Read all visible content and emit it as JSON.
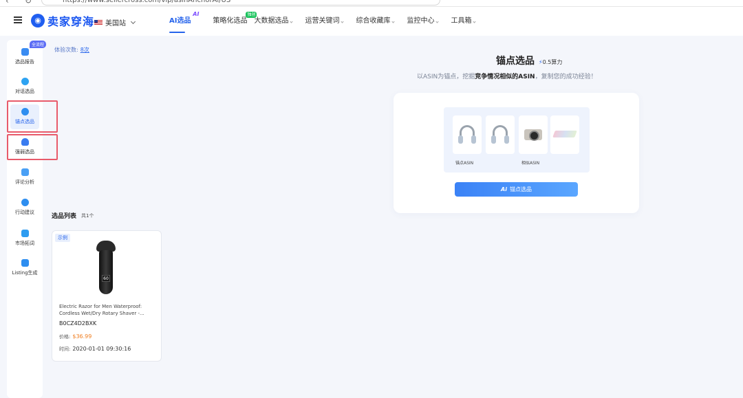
{
  "browser": {
    "url": "https://www.sellercross.com/vip/asinAnchorAi/US"
  },
  "header": {
    "logo_text": "卖家穿海",
    "site": "美国站",
    "nav": [
      {
        "label": "AI选品",
        "badge": "AI"
      },
      {
        "label": "策略化选品",
        "badge": "独创"
      },
      {
        "label": "大数据选品"
      },
      {
        "label": "运营关键词"
      },
      {
        "label": "综合收藏库"
      },
      {
        "label": "监控中心"
      },
      {
        "label": "工具箱"
      }
    ]
  },
  "sidebar": {
    "badge": "全流程",
    "items": [
      {
        "label": "选品报告",
        "icon": "report-icon"
      },
      {
        "label": "对话选品",
        "icon": "chat-icon"
      },
      {
        "label": "锚点选品",
        "icon": "anchor-icon"
      },
      {
        "label": "强弱选品",
        "icon": "person-icon"
      },
      {
        "label": "评论分析",
        "icon": "comment-icon"
      },
      {
        "label": "行动建议",
        "icon": "compass-icon"
      },
      {
        "label": "市场拓词",
        "icon": "keyword-icon"
      },
      {
        "label": "Listing生成",
        "icon": "listing-icon"
      }
    ]
  },
  "trial": {
    "label": "体验次数:",
    "count": "8次"
  },
  "tool": {
    "title": "锚点选品",
    "cost": "0.5算力",
    "subtitle_pre": "以ASIN为锚点，挖掘",
    "subtitle_bold": "竞争情况相似的ASIN",
    "subtitle_post": "，复制您的成功经验！",
    "anchor_label": "锚点ASIN",
    "similar_label": "相似ASIN",
    "button_label": "锚点选品"
  },
  "list": {
    "title": "选品列表",
    "count": "共1个",
    "products": [
      {
        "tag": "示例",
        "title": "Electric Razor for Men Waterproof: Cordless Wet/Dry Rotary Shaver -...",
        "asin": "B0CZ4D2BXK",
        "price_label": "价格:",
        "price": "$36.99",
        "time_label": "时间:",
        "time": "2020-01-01 09:30:16"
      }
    ]
  },
  "colors": {
    "accent": "#2563eb",
    "price": "#f07d1e",
    "highlight": "#e85a6a"
  }
}
